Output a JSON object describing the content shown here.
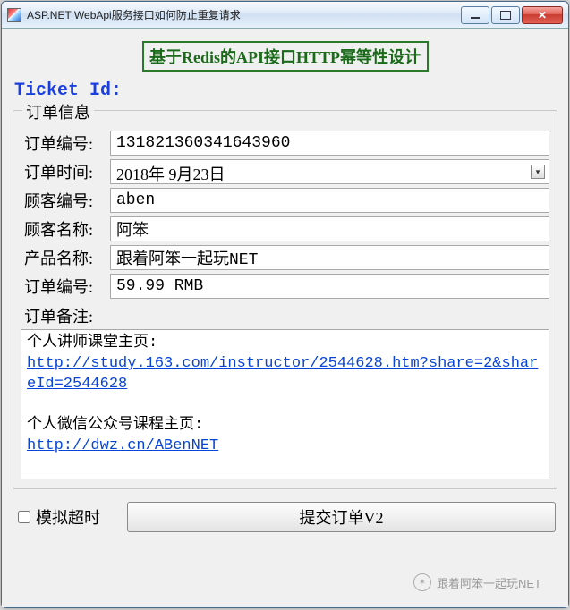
{
  "window": {
    "title": "ASP.NET WebApi服务接口如何防止重复请求"
  },
  "banner": "基于Redis的API接口HTTP幂等性设计",
  "ticket_label": "Ticket Id:",
  "group": {
    "title": "订单信息",
    "fields": {
      "order_no_label": "订单编号:",
      "order_no_value": "131821360341643960",
      "order_time_label": "订单时间:",
      "order_time_value": "2018年 9月23日",
      "customer_no_label": "顾客编号:",
      "customer_no_value": "aben",
      "customer_name_label": "顾客名称:",
      "customer_name_value": "阿笨",
      "product_name_label": "产品名称:",
      "product_name_value": "跟着阿笨一起玩NET",
      "price_label": "订单编号:",
      "price_value": "59.99 RMB",
      "remark_label": "订单备注:"
    },
    "remark": {
      "line1": "个人讲师课堂主页:",
      "link1": "http://study.163.com/instructor/2544628.htm?share=2&shareId=2544628",
      "line2": "个人微信公众号课程主页:",
      "link2": "http://dwz.cn/ABenNET"
    }
  },
  "bottom": {
    "timeout_label": "模拟超时",
    "submit_label": "提交订单V2"
  },
  "watermark": "跟着阿笨一起玩NET"
}
